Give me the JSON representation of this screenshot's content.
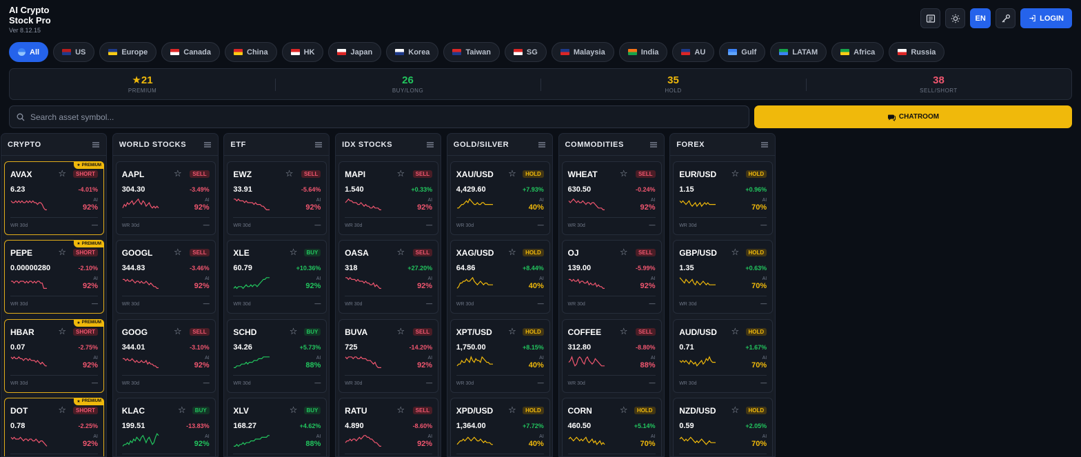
{
  "app": {
    "title_line1": "AI Crypto",
    "title_line2": "Stock Pro",
    "version": "Ver 8.12.15"
  },
  "header": {
    "lang": "EN",
    "login": "LOGIN"
  },
  "regions": [
    {
      "label": "All",
      "active": true,
      "flag": [
        "#3b82f6",
        "#93c5fd"
      ]
    },
    {
      "label": "US",
      "flag": [
        "#b91c1c",
        "#1e3a8a"
      ]
    },
    {
      "label": "Europe",
      "flag": [
        "#1e3a8a",
        "#facc15"
      ]
    },
    {
      "label": "Canada",
      "flag": [
        "#dc2626",
        "#ffffff"
      ]
    },
    {
      "label": "China",
      "flag": [
        "#dc2626",
        "#facc15"
      ]
    },
    {
      "label": "HK",
      "flag": [
        "#dc2626",
        "#ffffff"
      ]
    },
    {
      "label": "Japan",
      "flag": [
        "#ffffff",
        "#dc2626"
      ]
    },
    {
      "label": "Korea",
      "flag": [
        "#ffffff",
        "#1e3a8a"
      ]
    },
    {
      "label": "Taiwan",
      "flag": [
        "#dc2626",
        "#1e3a8a"
      ]
    },
    {
      "label": "SG",
      "flag": [
        "#dc2626",
        "#ffffff"
      ]
    },
    {
      "label": "Malaysia",
      "flag": [
        "#1e3a8a",
        "#dc2626"
      ]
    },
    {
      "label": "India",
      "flag": [
        "#f97316",
        "#16a34a"
      ]
    },
    {
      "label": "AU",
      "flag": [
        "#1e3a8a",
        "#dc2626"
      ]
    },
    {
      "label": "Gulf",
      "flag": [
        "#3b82f6",
        "#60a5fa"
      ]
    },
    {
      "label": "LATAM",
      "flag": [
        "#16a34a",
        "#3b82f6"
      ]
    },
    {
      "label": "Africa",
      "flag": [
        "#16a34a",
        "#facc15"
      ]
    },
    {
      "label": "Russia",
      "flag": [
        "#ffffff",
        "#dc2626"
      ]
    }
  ],
  "stats": [
    {
      "value": "21",
      "label": "PREMIUM",
      "star": true,
      "color": "#f0b90b"
    },
    {
      "value": "26",
      "label": "BUY/LONG",
      "color": "#22c55e"
    },
    {
      "value": "35",
      "label": "HOLD",
      "color": "#f0b90b"
    },
    {
      "value": "38",
      "label": "SELL/SHORT",
      "color": "#f0566f"
    }
  ],
  "search": {
    "placeholder": "Search asset symbol..."
  },
  "chatroom": {
    "label": "CHATROOM"
  },
  "premium_label": "PREMIUM",
  "ai_label": "AI",
  "wr_label": "WR 30d",
  "wr_value": "—",
  "columns": [
    {
      "title": "CRYPTO",
      "cards": [
        {
          "symbol": "AVAX",
          "premium": true,
          "signal": "SHORT",
          "price": "6.23",
          "change": "-4.01%",
          "ai": "92%",
          "spark": [
            6,
            5,
            5,
            6,
            5,
            6,
            5,
            6,
            5,
            5,
            6,
            5,
            6,
            5,
            6,
            5,
            5,
            4,
            5,
            5,
            4,
            2,
            1,
            1
          ]
        },
        {
          "symbol": "PEPE",
          "premium": true,
          "signal": "SHORT",
          "price": "0.00000280",
          "change": "-2.10%",
          "ai": "92%",
          "spark": [
            5,
            5,
            4,
            5,
            5,
            4,
            5,
            5,
            5,
            4,
            5,
            4,
            5,
            5,
            4,
            5,
            4,
            5,
            5,
            4,
            4,
            1,
            1,
            1
          ]
        },
        {
          "symbol": "HBAR",
          "premium": true,
          "signal": "SHORT",
          "price": "0.07",
          "change": "-2.75%",
          "ai": "92%",
          "spark": [
            7,
            6,
            7,
            6,
            6,
            7,
            6,
            6,
            5,
            6,
            6,
            5,
            6,
            5,
            5,
            5,
            4,
            5,
            4,
            3,
            4,
            3,
            2,
            2
          ]
        },
        {
          "symbol": "DOT",
          "premium": true,
          "signal": "SHORT",
          "price": "0.78",
          "change": "-2.25%",
          "ai": "92%",
          "spark": [
            6,
            5,
            6,
            5,
            5,
            5,
            6,
            5,
            4,
            5,
            5,
            4,
            5,
            5,
            4,
            4,
            5,
            4,
            3,
            4,
            4,
            3,
            2,
            1
          ]
        }
      ]
    },
    {
      "title": "WORLD STOCKS",
      "cards": [
        {
          "symbol": "AAPL",
          "signal": "SELL",
          "price": "304.30",
          "change": "-3.49%",
          "ai": "92%",
          "spark": [
            2,
            4,
            3,
            5,
            4,
            5,
            6,
            4,
            5,
            6,
            7,
            5,
            4,
            6,
            5,
            3,
            4,
            5,
            3,
            2,
            3,
            2,
            3,
            2
          ]
        },
        {
          "symbol": "GOOGL",
          "signal": "SELL",
          "price": "344.83",
          "change": "-3.46%",
          "ai": "92%",
          "spark": [
            6,
            6,
            5,
            6,
            5,
            5,
            6,
            5,
            4,
            5,
            5,
            4,
            5,
            4,
            4,
            5,
            4,
            3,
            4,
            3,
            2,
            2,
            1,
            1
          ]
        },
        {
          "symbol": "GOOG",
          "signal": "SELL",
          "price": "344.01",
          "change": "-3.10%",
          "ai": "92%",
          "spark": [
            6,
            6,
            5,
            6,
            5,
            5,
            6,
            5,
            4,
            5,
            4,
            4,
            5,
            4,
            4,
            5,
            3,
            4,
            3,
            3,
            2,
            2,
            1,
            1
          ]
        },
        {
          "symbol": "KLAC",
          "signal": "BUY",
          "price": "199.51",
          "change": "-13.83%",
          "ai": "92%",
          "spark": [
            1,
            2,
            2,
            3,
            2,
            4,
            3,
            5,
            4,
            6,
            5,
            4,
            6,
            7,
            5,
            3,
            5,
            6,
            4,
            2,
            3,
            6,
            8,
            7
          ]
        }
      ]
    },
    {
      "title": "ETF",
      "cards": [
        {
          "symbol": "EWZ",
          "signal": "SELL",
          "price": "33.91",
          "change": "-5.64%",
          "ai": "92%",
          "spark": [
            7,
            7,
            6,
            7,
            6,
            6,
            6,
            5,
            6,
            5,
            5,
            5,
            5,
            4,
            5,
            4,
            4,
            4,
            3,
            3,
            2,
            1,
            1,
            1
          ]
        },
        {
          "symbol": "XLE",
          "signal": "BUY",
          "price": "60.79",
          "change": "+10.36%",
          "ai": "92%",
          "spark": [
            1,
            2,
            1,
            2,
            2,
            2,
            1,
            2,
            3,
            2,
            2,
            3,
            2,
            3,
            3,
            2,
            3,
            4,
            5,
            6,
            6,
            7,
            7,
            7
          ]
        },
        {
          "symbol": "SCHD",
          "signal": "BUY",
          "price": "34.26",
          "change": "+5.73%",
          "ai": "88%",
          "spark": [
            1,
            1,
            2,
            2,
            2,
            3,
            3,
            3,
            4,
            3,
            4,
            4,
            4,
            5,
            5,
            5,
            6,
            6,
            6,
            7,
            7,
            7,
            7,
            7
          ]
        },
        {
          "symbol": "XLV",
          "signal": "BUY",
          "price": "168.27",
          "change": "+4.62%",
          "ai": "88%",
          "spark": [
            1,
            1,
            2,
            1,
            2,
            2,
            3,
            2,
            3,
            3,
            3,
            4,
            4,
            4,
            5,
            5,
            5,
            5,
            6,
            6,
            6,
            6,
            7,
            7
          ]
        }
      ]
    },
    {
      "title": "IDX STOCKS",
      "cards": [
        {
          "symbol": "MAPI",
          "signal": "SELL",
          "price": "1.540",
          "change": "+0.33%",
          "ai": "92%",
          "spark": [
            5,
            6,
            7,
            6,
            6,
            5,
            5,
            5,
            4,
            4,
            5,
            4,
            3,
            4,
            3,
            3,
            2,
            2,
            3,
            2,
            2,
            2,
            1,
            1
          ]
        },
        {
          "symbol": "OASA",
          "signal": "SELL",
          "price": "318",
          "change": "+27.20%",
          "ai": "92%",
          "spark": [
            7,
            7,
            6,
            7,
            6,
            6,
            6,
            5,
            6,
            5,
            5,
            5,
            4,
            5,
            4,
            4,
            3,
            3,
            4,
            2,
            3,
            2,
            1,
            1
          ]
        },
        {
          "symbol": "BUVA",
          "signal": "SELL",
          "price": "725",
          "change": "-14.20%",
          "ai": "92%",
          "spark": [
            7,
            6,
            7,
            7,
            7,
            6,
            7,
            7,
            6,
            6,
            7,
            6,
            6,
            6,
            5,
            5,
            5,
            4,
            3,
            4,
            2,
            1,
            1,
            1
          ]
        },
        {
          "symbol": "RATU",
          "signal": "SELL",
          "price": "4.890",
          "change": "-8.60%",
          "ai": "92%",
          "spark": [
            3,
            4,
            4,
            5,
            4,
            5,
            5,
            4,
            5,
            6,
            5,
            6,
            7,
            7,
            6,
            6,
            5,
            5,
            4,
            3,
            3,
            2,
            1,
            1
          ]
        }
      ]
    },
    {
      "title": "GOLD/SILVER",
      "cards": [
        {
          "symbol": "XAU/USD",
          "signal": "HOLD",
          "price": "4,429.60",
          "change": "+7.93%",
          "ai": "40%",
          "spark": [
            2,
            2,
            3,
            4,
            4,
            5,
            6,
            5,
            7,
            6,
            5,
            4,
            4,
            5,
            4,
            4,
            5,
            5,
            4,
            4,
            4,
            4,
            4,
            4
          ]
        },
        {
          "symbol": "XAG/USD",
          "signal": "HOLD",
          "price": "64.86",
          "change": "+8.44%",
          "ai": "40%",
          "spark": [
            1,
            2,
            4,
            4,
            5,
            5,
            6,
            5,
            5,
            6,
            7,
            5,
            4,
            3,
            4,
            5,
            4,
            3,
            4,
            4,
            3,
            3,
            3,
            3
          ]
        },
        {
          "symbol": "XPT/USD",
          "signal": "HOLD",
          "price": "1,750.00",
          "change": "+8.15%",
          "ai": "40%",
          "spark": [
            2,
            3,
            3,
            5,
            4,
            4,
            6,
            5,
            4,
            7,
            5,
            4,
            6,
            5,
            5,
            4,
            7,
            6,
            5,
            4,
            4,
            3,
            3,
            3
          ]
        },
        {
          "symbol": "XPD/USD",
          "signal": "HOLD",
          "price": "1,364.00",
          "change": "+7.72%",
          "ai": "40%",
          "spark": [
            2,
            3,
            4,
            4,
            5,
            4,
            5,
            6,
            5,
            4,
            5,
            6,
            5,
            4,
            4,
            5,
            4,
            3,
            4,
            3,
            3,
            3,
            2,
            2
          ]
        }
      ]
    },
    {
      "title": "COMMODITIES",
      "cards": [
        {
          "symbol": "WHEAT",
          "signal": "SELL",
          "price": "630.50",
          "change": "-0.24%",
          "ai": "92%",
          "spark": [
            6,
            5,
            6,
            7,
            6,
            5,
            6,
            5,
            5,
            6,
            5,
            4,
            5,
            5,
            4,
            5,
            5,
            4,
            3,
            2,
            2,
            2,
            1,
            1
          ]
        },
        {
          "symbol": "OJ",
          "signal": "SELL",
          "price": "139.00",
          "change": "-5.99%",
          "ai": "92%",
          "spark": [
            6,
            6,
            5,
            6,
            5,
            5,
            6,
            4,
            5,
            5,
            4,
            4,
            5,
            3,
            4,
            3,
            3,
            4,
            2,
            3,
            2,
            2,
            1,
            1
          ]
        },
        {
          "symbol": "COFFEE",
          "signal": "SELL",
          "price": "312.80",
          "change": "-8.80%",
          "ai": "88%",
          "spark": [
            4,
            5,
            7,
            4,
            2,
            3,
            6,
            7,
            6,
            4,
            3,
            6,
            7,
            5,
            4,
            3,
            4,
            6,
            5,
            4,
            3,
            2,
            2,
            2
          ]
        },
        {
          "symbol": "CORN",
          "signal": "HOLD",
          "price": "460.50",
          "change": "+5.14%",
          "ai": "70%",
          "spark": [
            5,
            6,
            5,
            4,
            5,
            6,
            5,
            4,
            5,
            4,
            5,
            6,
            4,
            3,
            4,
            5,
            3,
            4,
            2,
            3,
            4,
            2,
            3,
            2
          ]
        }
      ]
    },
    {
      "title": "FOREX",
      "cards": [
        {
          "symbol": "EUR/USD",
          "signal": "HOLD",
          "price": "1.15",
          "change": "+0.96%",
          "ai": "70%",
          "spark": [
            6,
            5,
            6,
            5,
            4,
            5,
            6,
            4,
            3,
            4,
            5,
            3,
            4,
            5,
            3,
            4,
            5,
            4,
            5,
            4,
            4,
            4,
            4,
            4
          ]
        },
        {
          "symbol": "GBP/USD",
          "signal": "HOLD",
          "price": "1.35",
          "change": "+0.63%",
          "ai": "70%",
          "spark": [
            7,
            6,
            5,
            4,
            6,
            5,
            4,
            5,
            6,
            4,
            3,
            5,
            4,
            3,
            4,
            5,
            4,
            3,
            4,
            3,
            3,
            3,
            3,
            3
          ]
        },
        {
          "symbol": "AUD/USD",
          "signal": "HOLD",
          "price": "0.71",
          "change": "+1.67%",
          "ai": "70%",
          "spark": [
            5,
            4,
            5,
            4,
            5,
            4,
            3,
            5,
            4,
            3,
            4,
            2,
            3,
            4,
            5,
            3,
            4,
            6,
            5,
            7,
            5,
            4,
            4,
            4
          ]
        },
        {
          "symbol": "NZD/USD",
          "signal": "HOLD",
          "price": "0.59",
          "change": "+2.05%",
          "ai": "70%",
          "spark": [
            5,
            6,
            5,
            4,
            5,
            4,
            5,
            6,
            5,
            4,
            3,
            4,
            3,
            4,
            5,
            4,
            3,
            2,
            3,
            4,
            3,
            3,
            3,
            3
          ]
        }
      ]
    }
  ]
}
